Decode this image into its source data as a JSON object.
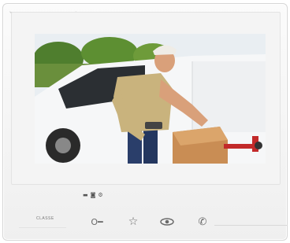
{
  "device": {
    "brand_label": "Classe",
    "status_icons": [
      "mic-icon",
      "speaker-icon",
      "settings-icon"
    ],
    "buttons": [
      {
        "name": "door-lock-button",
        "icon": "key-icon",
        "glyph": "O─"
      },
      {
        "name": "favorite-button",
        "icon": "star-icon",
        "glyph": "☆"
      },
      {
        "name": "camera-cycle-button",
        "icon": "eye-icon",
        "glyph": "👁"
      },
      {
        "name": "answer-call-button",
        "icon": "phone-icon",
        "glyph": "☏"
      }
    ]
  },
  "colors": {
    "frame": "#f3f3f3",
    "icon": "#6a6a6a"
  }
}
